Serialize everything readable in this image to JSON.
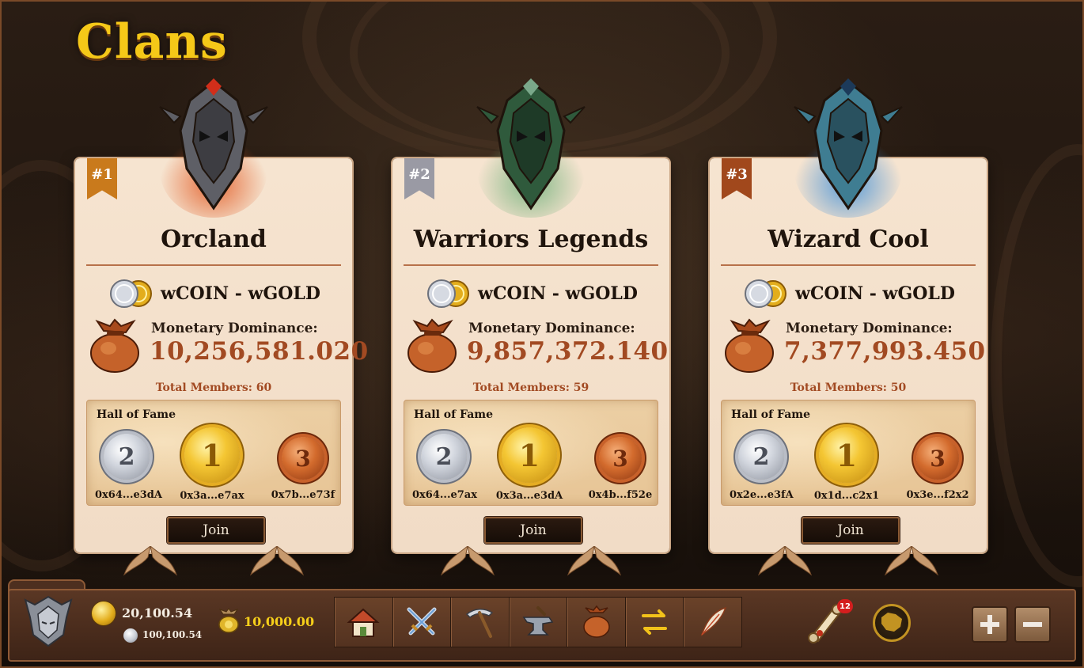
{
  "page": {
    "title": "Clans"
  },
  "clans": [
    {
      "rank": "#1",
      "name": "Orcland",
      "pair": "wCOIN - wGOLD",
      "dominance_label": "Monetary Dominance:",
      "dominance_value": "10,256,581.020",
      "members_text": "Total Members: 60",
      "hall_title": "Hall of Fame",
      "hall": [
        {
          "place": "2",
          "medal": "silver",
          "address": "0x64...e3dA"
        },
        {
          "place": "1",
          "medal": "gold",
          "address": "0x3a...e7ax"
        },
        {
          "place": "3",
          "medal": "bronze",
          "address": "0x7b...e73f"
        }
      ],
      "join_label": "Join",
      "emblem": "orc-helmet-icon",
      "glow": "#e1561e"
    },
    {
      "rank": "#2",
      "name": "Warriors Legends",
      "pair": "wCOIN - wGOLD",
      "dominance_label": "Monetary Dominance:",
      "dominance_value": "9,857,372.140",
      "members_text": "Total Members: 59",
      "hall_title": "Hall of Fame",
      "hall": [
        {
          "place": "2",
          "medal": "silver",
          "address": "0x64...e7ax"
        },
        {
          "place": "1",
          "medal": "gold",
          "address": "0x3a...e3dA"
        },
        {
          "place": "3",
          "medal": "bronze",
          "address": "0x4b...f52e"
        }
      ],
      "join_label": "Join",
      "emblem": "knight-shield-icon",
      "glow": "#6fb07a"
    },
    {
      "rank": "#3",
      "name": "Wizard Cool",
      "pair": "wCOIN - wGOLD",
      "dominance_label": "Monetary Dominance:",
      "dominance_value": "7,377,993.450",
      "members_text": "Total Members: 50",
      "hall_title": "Hall of Fame",
      "hall": [
        {
          "place": "2",
          "medal": "silver",
          "address": "0x2e...e3fA"
        },
        {
          "place": "1",
          "medal": "gold",
          "address": "0x1d...c2x1"
        },
        {
          "place": "3",
          "medal": "bronze",
          "address": "0x3e...f2x2"
        }
      ],
      "join_label": "Join",
      "emblem": "wizard-mask-icon",
      "glow": "#3f8fd8"
    }
  ],
  "bottom_bar": {
    "gold_amount": "20,100.54",
    "silver_amount": "100,100.54",
    "pouch_amount": "10,000.00",
    "tools": [
      "house-icon",
      "crossed-swords-icon",
      "pickaxe-icon",
      "anvil-icon",
      "coin-bag-icon",
      "exchange-arrows-icon",
      "quill-icon"
    ],
    "notification_count": "12",
    "zoom_in": "zoom-in",
    "zoom_out": "zoom-out"
  },
  "colors": {
    "title": "#f5c818",
    "accent_red": "#a24a22",
    "card_bg": "#f6e4d0",
    "pouch_amount": "#f6cf1a"
  }
}
